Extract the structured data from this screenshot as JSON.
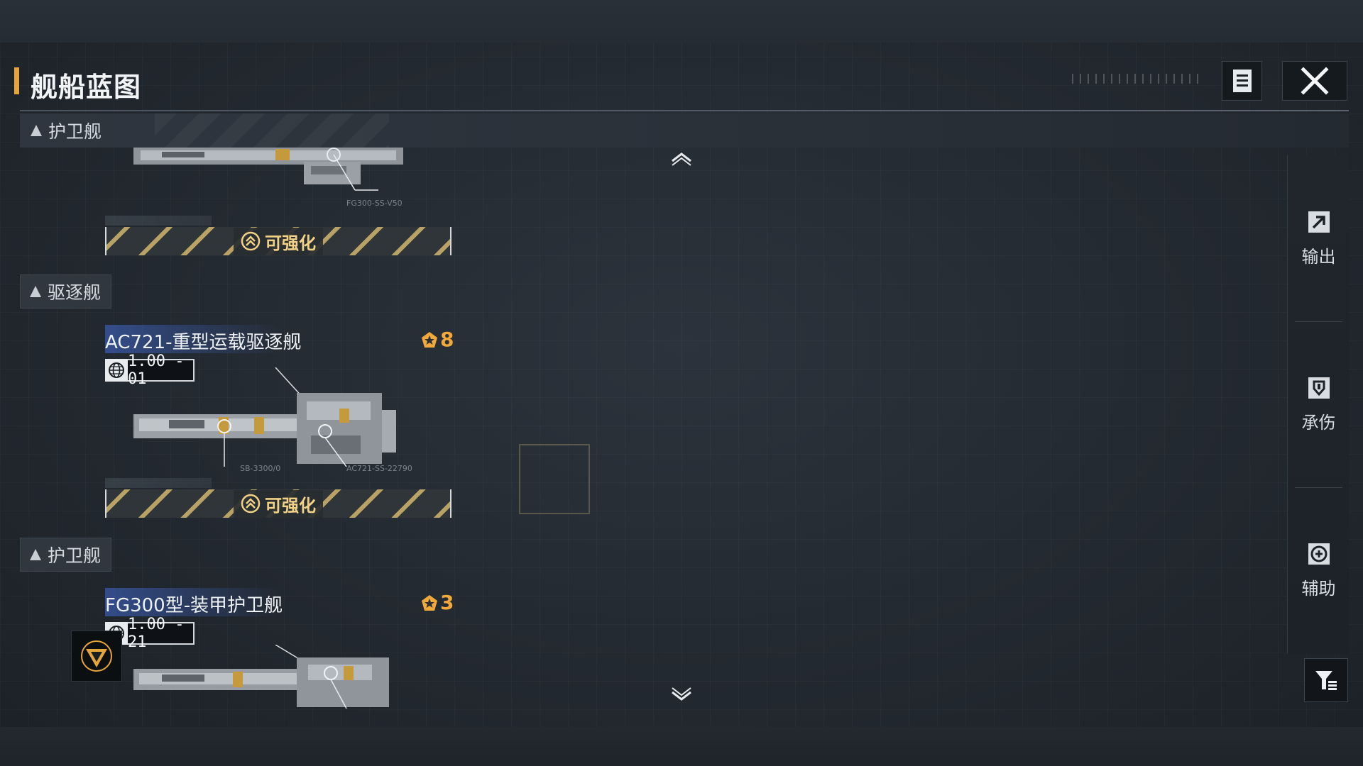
{
  "header": {
    "title": "舰船蓝图",
    "notes_icon": "document-list-icon",
    "close_icon": "close-x-icon"
  },
  "categories": {
    "sticky": "护卫舰",
    "destroyer": "驱逐舰",
    "frigate": "护卫舰"
  },
  "ships": [
    {
      "name": "",
      "level": "",
      "version": "",
      "enhance_label": "可强化",
      "tags": [
        "FG300-SS-V50"
      ]
    },
    {
      "name": "AC721-重型运载驱逐舰",
      "level": "8",
      "version": "1.00 - 01",
      "enhance_label": "可强化",
      "tags": [
        "SB-3300/0",
        "AC721-SS-22790"
      ]
    },
    {
      "name": "FG300型-装甲护卫舰",
      "level": "3",
      "version": "1.00 - 21",
      "enhance_label": "",
      "tags": []
    }
  ],
  "side_panel": {
    "items": [
      {
        "label": "输出",
        "icon": "export-arrow-icon"
      },
      {
        "label": "承伤",
        "icon": "shield-icon"
      },
      {
        "label": "辅助",
        "icon": "support-crosshair-icon"
      }
    ],
    "filter_icon": "filter-sort-icon"
  },
  "colors": {
    "accent_orange": "#e6a53a",
    "level_gold": "#f0a93a",
    "enhance_text": "#f1d185",
    "name_highlight": "#3a5aaa"
  }
}
